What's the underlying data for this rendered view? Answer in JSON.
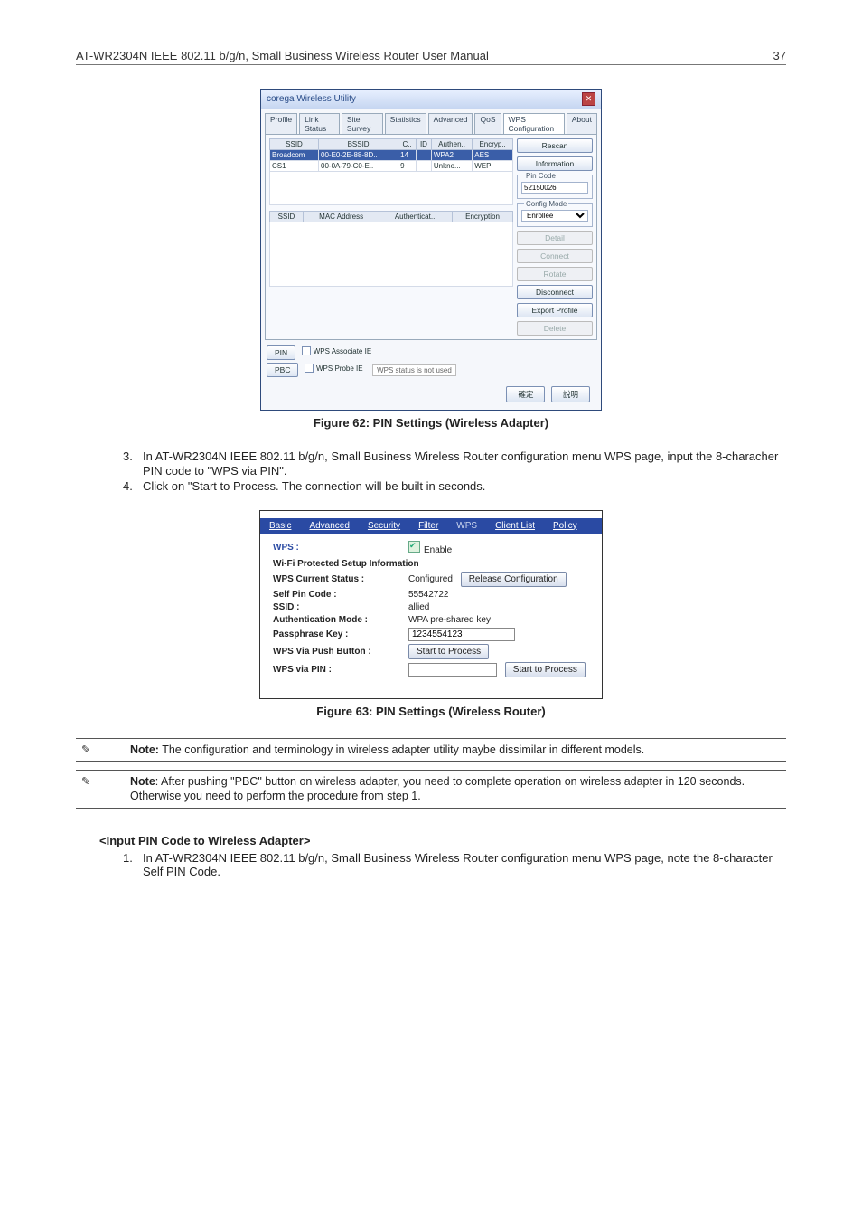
{
  "header": {
    "title": "AT-WR2304N IEEE 802.11 b/g/n, Small Business Wireless Router User Manual",
    "page": "37"
  },
  "step3": {
    "num": "3.",
    "text": "In AT-WR2304N IEEE 802.11 b/g/n, Small Business Wireless Router configuration menu WPS page, input the 8-characher PIN code to \"WPS via PIN\"."
  },
  "step4": {
    "num": "4.",
    "text": "Click on \"Start to Process. The connection will be built in seconds."
  },
  "caption62": "Figure 62: PIN Settings (Wireless Adapter)",
  "caption63": "Figure 63: PIN Settings (Wireless Router)",
  "note1": "Note: The configuration and terminology in wireless adapter utility maybe dissimilar in different models.",
  "note2": "Note: After pushing \"PBC\" button on wireless adapter, you need to complete operation on wireless adapter in 120 seconds. Otherwise you need to perform the procedure from step 1.",
  "section2": "<Input PIN Code to Wireless Adapter>",
  "step2_1": {
    "num": "1.",
    "text": "In AT-WR2304N IEEE 802.11 b/g/n, Small Business Wireless Router configuration menu WPS page, note the 8-character Self PIN Code."
  },
  "win62": {
    "title": "corega Wireless Utility",
    "tabs": [
      "Profile",
      "Link Status",
      "Site Survey",
      "Statistics",
      "Advanced",
      "QoS",
      "WPS Configuration",
      "About"
    ],
    "th1": [
      "SSID",
      "BSSID",
      "C..",
      "ID",
      "Authen..",
      "Encryp.."
    ],
    "rows1": [
      {
        "ssid": "Broadcom",
        "bssid": "00-E0-2E-88-8D..",
        "c": "14",
        "id": "",
        "auth": "WPA2",
        "enc": "AES"
      },
      {
        "ssid": "CS1",
        "bssid": "00-0A-79-C0-E..",
        "c": "9",
        "id": "",
        "auth": "Unkno...",
        "enc": "WEP"
      }
    ],
    "th2": [
      "SSID",
      "MAC Address",
      "Authenticat...",
      "Encryption"
    ],
    "side": {
      "rescan": "Rescan",
      "information": "Information",
      "pincode_lbl": "Pin Code",
      "pincode_val": "52150026",
      "config_lbl": "Config Mode",
      "config_val": "Enrollee",
      "detail": "Detail",
      "connect": "Connect",
      "rotate": "Rotate",
      "disconnect": "Disconnect",
      "export": "Export Profile",
      "delete": "Delete"
    },
    "pin_btn": "PIN",
    "pbc_btn": "PBC",
    "assoc": "WPS Associate IE",
    "probe": "WPS Probe IE",
    "status": "WPS status is not used",
    "ok": "確定",
    "cancel": "說明"
  },
  "panel63": {
    "tabs": [
      "Basic",
      "Advanced",
      "Security",
      "Filter",
      "WPS",
      "Client List",
      "Policy"
    ],
    "wps_lbl": "WPS :",
    "enable": "Enable",
    "info_hdr": "Wi-Fi Protected Setup Information",
    "cur_lbl": "WPS Current Status :",
    "cur_val": "Configured",
    "release": "Release Configuration",
    "self_lbl": "Self Pin Code :",
    "self_val": "55542722",
    "ssid_lbl": "SSID :",
    "ssid_val": "allied",
    "auth_lbl": "Authentication Mode :",
    "auth_val": "WPA pre-shared key",
    "pass_lbl": "Passphrase Key :",
    "pass_val": "1234554123",
    "push_lbl": "WPS Via Push Button :",
    "pin_lbl": "WPS via PIN :",
    "start": "Start to Process"
  }
}
